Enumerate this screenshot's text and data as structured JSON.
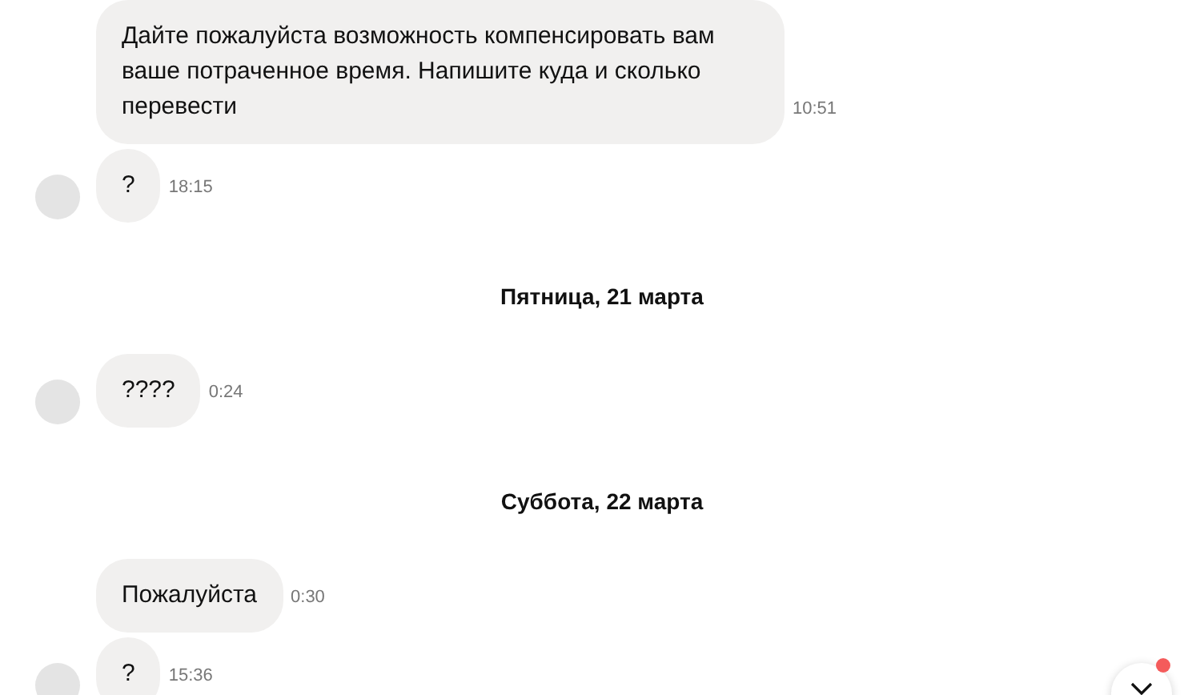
{
  "messages": [
    {
      "kind": "message",
      "text": "Дайте пожалуйста возможность компенсировать вам ваше потраченное время. Напишите куда и сколько перевести",
      "time": "10:51",
      "avatar": false
    },
    {
      "kind": "message",
      "text": "?",
      "time": "18:15",
      "avatar": true
    },
    {
      "kind": "date",
      "text": "Пятница, 21 марта"
    },
    {
      "kind": "message",
      "text": "????",
      "time": "0:24",
      "avatar": true
    },
    {
      "kind": "date",
      "text": "Суббота, 22 марта"
    },
    {
      "kind": "message",
      "text": "Пожалуйста",
      "time": "0:30",
      "avatar": false
    },
    {
      "kind": "message",
      "text": "?",
      "time": "15:36",
      "avatar": true
    }
  ],
  "scroll_button": {
    "unread": true
  }
}
